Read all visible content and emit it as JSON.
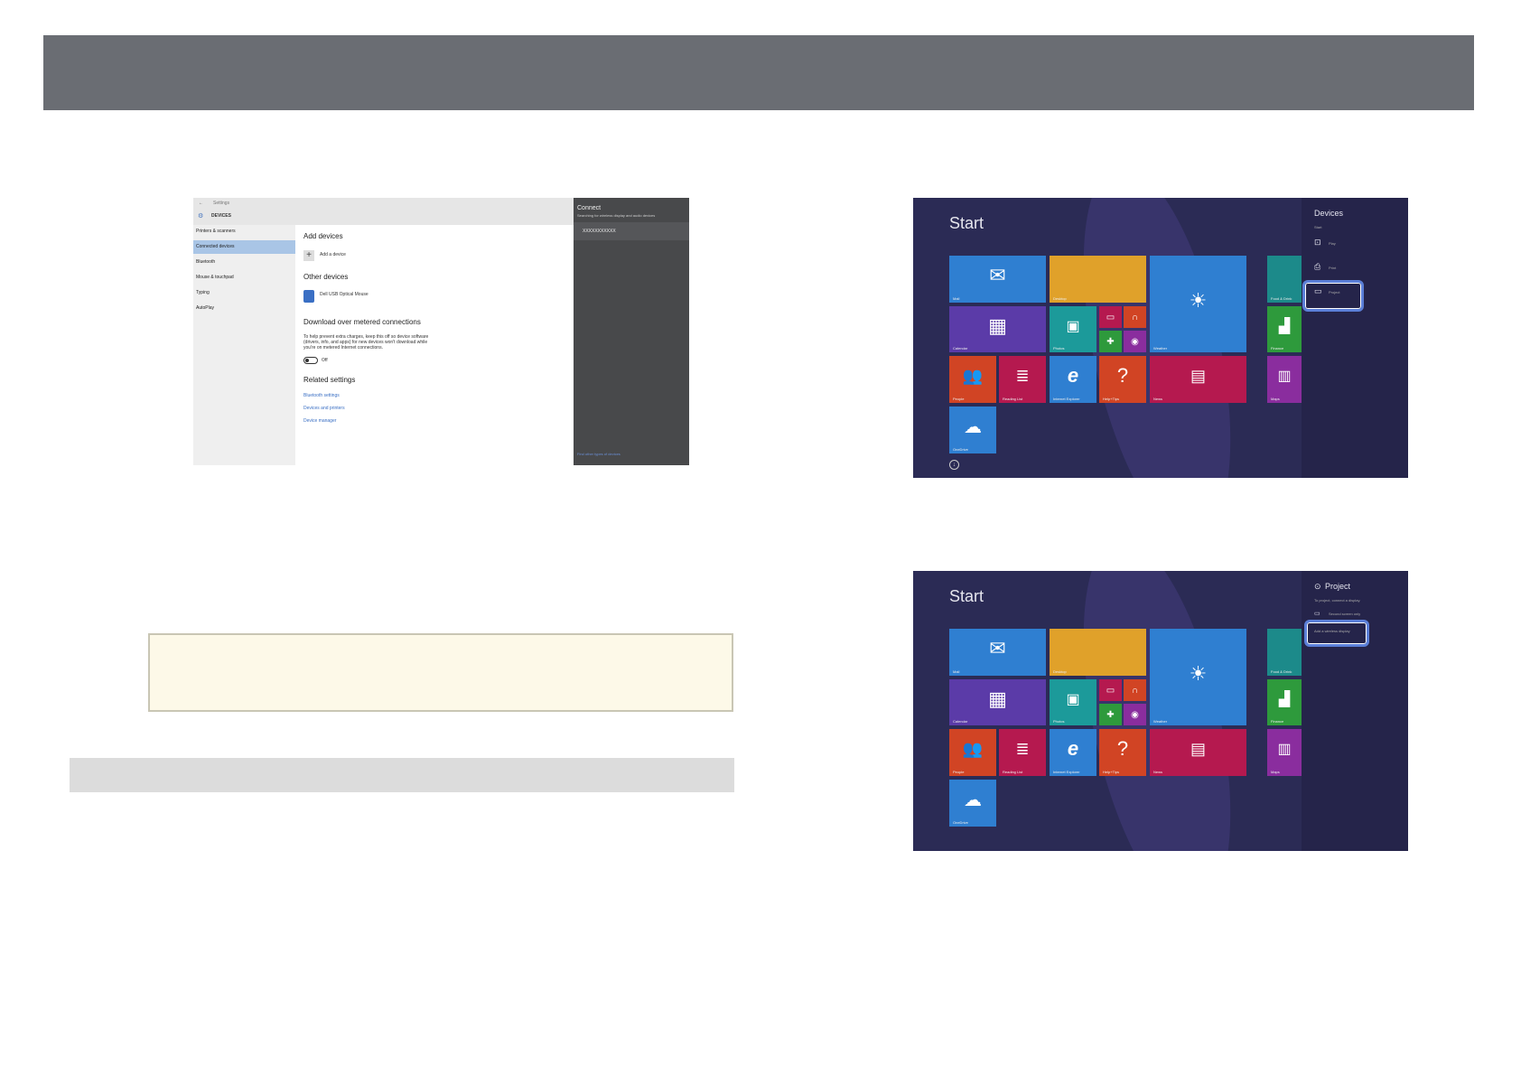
{
  "settings_screenshot": {
    "back_label": "←",
    "window_title": "Settings",
    "section": "DEVICES",
    "sidebar": [
      "Printers & scanners",
      "Connected devices",
      "Bluetooth",
      "Mouse & touchpad",
      "Typing",
      "AutoPlay"
    ],
    "add_devices_heading": "Add devices",
    "add_device_label": "Add a device",
    "other_devices_heading": "Other devices",
    "other_device_name": "Dell USB Optical Mouse",
    "download_heading": "Download over metered connections",
    "download_desc": [
      "To help prevent extra charges, keep this off so device software",
      "(drivers, info, and apps) for new devices won't download while",
      "you're on metered Internet connections."
    ],
    "toggle_state": "Off",
    "related_heading": "Related settings",
    "related_links": [
      "Bluetooth settings",
      "Devices and printers",
      "Device manager"
    ],
    "connect_panel": {
      "title": "Connect",
      "subtitle": "Searching for wireless display and audio devices",
      "device": "XXXXXXXXXXX",
      "footer_link": "Find other types of devices"
    }
  },
  "start_screen_1": {
    "title": "Start",
    "charm": {
      "title": "Devices",
      "subtitle": "Start",
      "items": [
        "Play",
        "Print",
        "Project"
      ]
    },
    "tiles": [
      "Mail",
      "Desktop",
      "Weather",
      "Food & Drink",
      "Calendar",
      "Photos",
      "Finance",
      "People",
      "Reading List",
      "Internet Explorer",
      "Help+Tips",
      "News",
      "Maps",
      "OneDrive"
    ]
  },
  "start_screen_2": {
    "title": "Start",
    "charm": {
      "title": "Project",
      "subtitle": "To project, connect a display.",
      "items": [
        "Second screen only",
        "Add a wireless display"
      ]
    },
    "tiles": [
      "Mail",
      "Desktop",
      "Weather",
      "Food & Drink",
      "Calendar",
      "Photos",
      "Finance",
      "People",
      "Reading List",
      "Internet Explorer",
      "Help+Tips",
      "News",
      "Maps",
      "OneDrive"
    ]
  },
  "colors": {
    "header": "#6a6d73",
    "mail": "#2f7fd1",
    "desktop": "#e0a12a",
    "weather": "#2f7fd1",
    "calendar": "#5b3ba8",
    "photos": "#1c9a9a",
    "people": "#d14424",
    "reading": "#b5194f",
    "ie": "#2f7fd1",
    "help": "#d14424",
    "news": "#b5194f",
    "onedrive": "#2f7fd1",
    "finance": "#2e9a3c",
    "maps": "#8a2d9e",
    "highlight": "#5b7fd8"
  }
}
